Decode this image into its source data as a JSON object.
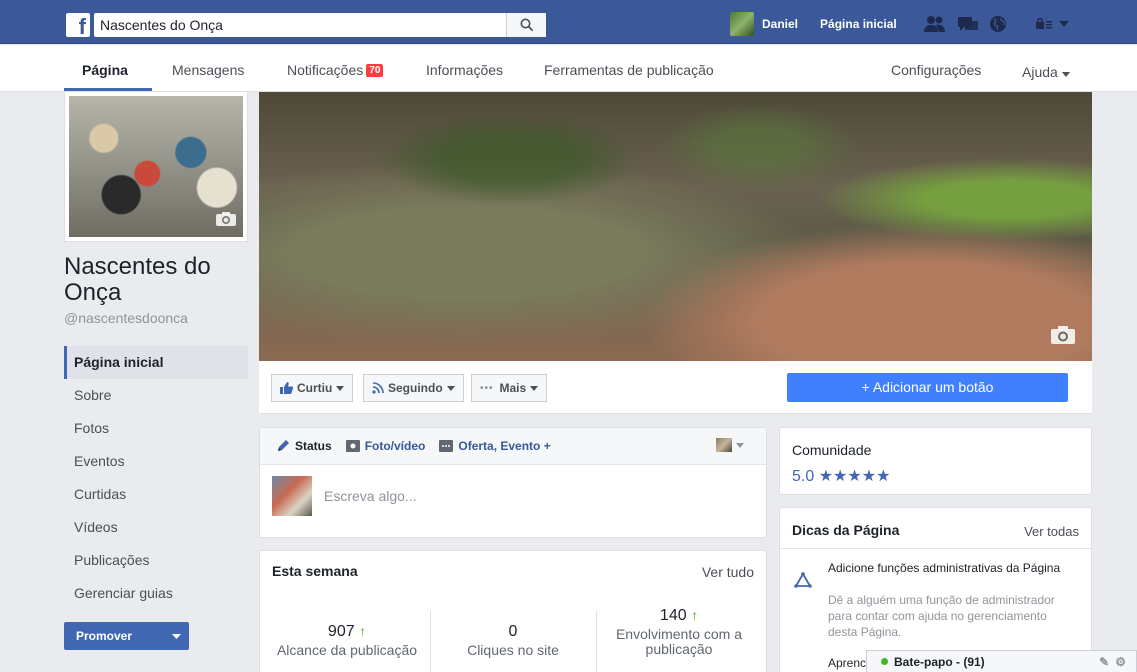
{
  "topbar": {
    "search_value": "Nascentes do Onça",
    "user_name": "Daniel",
    "home_label": "Página inicial"
  },
  "pagenav": {
    "items": [
      {
        "label": "Página"
      },
      {
        "label": "Mensagens"
      },
      {
        "label": "Notificações"
      },
      {
        "label": "Informações"
      },
      {
        "label": "Ferramentas de publicação"
      },
      {
        "label": "Configurações"
      },
      {
        "label": "Ajuda"
      }
    ],
    "notifications_count": "70"
  },
  "page": {
    "name": "Nascentes do Onça",
    "handle": "@nascentesdoonca"
  },
  "left_menu": [
    {
      "label": "Página inicial"
    },
    {
      "label": "Sobre"
    },
    {
      "label": "Fotos"
    },
    {
      "label": "Eventos"
    },
    {
      "label": "Curtidas"
    },
    {
      "label": "Vídeos"
    },
    {
      "label": "Publicações"
    },
    {
      "label": "Gerenciar guias"
    }
  ],
  "promote_label": "Promover",
  "actions": {
    "liked": "Curtiu",
    "following": "Seguindo",
    "more": "Mais",
    "add_button": "+ Adicionar um botão"
  },
  "composer": {
    "tabs": [
      {
        "label": "Status"
      },
      {
        "label": "Foto/vídeo"
      },
      {
        "label": "Oferta, Evento +"
      }
    ],
    "placeholder": "Escreva algo..."
  },
  "week": {
    "title": "Esta semana",
    "link": "Ver tudo",
    "stats": [
      {
        "value": "907",
        "label": "Alcance da publicação"
      },
      {
        "value": "0",
        "label": "Cliques no site"
      },
      {
        "value": "140",
        "label": "Envolvimento com a publicação"
      }
    ]
  },
  "community": {
    "title": "Comunidade",
    "rating": "5.0 ★★★★★"
  },
  "tips": {
    "title": "Dicas da Página",
    "link": "Ver todas",
    "tip1_head": "Adicione funções administrativas da Página",
    "tip1_desc": "Dê a alguém uma função de administrador para contar com ajuda no gerenciamento desta Página.",
    "tip2_head": "Aprenc"
  },
  "chat": {
    "label": "Bate-papo - (91)"
  },
  "colors": {
    "brand_blue": "#3b5998",
    "button_blue": "#4080ff",
    "badge_red": "#fa3e3e",
    "up_green": "#42b72a"
  }
}
